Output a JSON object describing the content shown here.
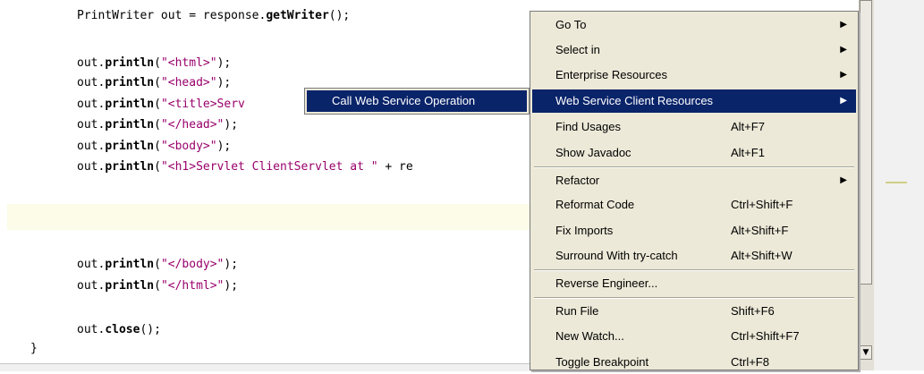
{
  "editor": {
    "lines": [
      {
        "parts": [
          {
            "t": "PrintWriter out = response.",
            "c": ""
          },
          {
            "t": "getWriter",
            "c": "kw"
          },
          {
            "t": "();",
            "c": ""
          }
        ]
      },
      {
        "parts": [
          {
            "t": "out.",
            "c": ""
          },
          {
            "t": "println",
            "c": "kw"
          },
          {
            "t": "(",
            "c": ""
          },
          {
            "t": "\"<html>\"",
            "c": "str"
          },
          {
            "t": ");",
            "c": ""
          }
        ]
      },
      {
        "parts": [
          {
            "t": "out.",
            "c": ""
          },
          {
            "t": "println",
            "c": "kw"
          },
          {
            "t": "(",
            "c": ""
          },
          {
            "t": "\"<head>\"",
            "c": "str"
          },
          {
            "t": ");",
            "c": ""
          }
        ]
      },
      {
        "parts": [
          {
            "t": "out.",
            "c": ""
          },
          {
            "t": "println",
            "c": "kw"
          },
          {
            "t": "(",
            "c": ""
          },
          {
            "t": "\"<title>Serv",
            "c": "str"
          }
        ]
      },
      {
        "parts": [
          {
            "t": "out.",
            "c": ""
          },
          {
            "t": "println",
            "c": "kw"
          },
          {
            "t": "(",
            "c": ""
          },
          {
            "t": "\"</head>\"",
            "c": "str"
          },
          {
            "t": ");",
            "c": ""
          }
        ]
      },
      {
        "parts": [
          {
            "t": "out.",
            "c": ""
          },
          {
            "t": "println",
            "c": "kw"
          },
          {
            "t": "(",
            "c": ""
          },
          {
            "t": "\"<body>\"",
            "c": "str"
          },
          {
            "t": ");",
            "c": ""
          }
        ]
      },
      {
        "parts": [
          {
            "t": "out.",
            "c": ""
          },
          {
            "t": "println",
            "c": "kw"
          },
          {
            "t": "(",
            "c": ""
          },
          {
            "t": "\"<h1>Servlet ClientServlet at \"",
            "c": "str"
          },
          {
            "t": " + re",
            "c": ""
          }
        ]
      },
      {
        "parts": [
          {
            "t": "out.",
            "c": ""
          },
          {
            "t": "println",
            "c": "kw"
          },
          {
            "t": "(",
            "c": ""
          },
          {
            "t": "\"</body>\"",
            "c": "str"
          },
          {
            "t": ");",
            "c": ""
          }
        ]
      },
      {
        "parts": [
          {
            "t": "out.",
            "c": ""
          },
          {
            "t": "println",
            "c": "kw"
          },
          {
            "t": "(",
            "c": ""
          },
          {
            "t": "\"</html>\"",
            "c": "str"
          },
          {
            "t": ");",
            "c": ""
          }
        ]
      },
      {
        "parts": [
          {
            "t": "out.",
            "c": ""
          },
          {
            "t": "close",
            "c": "kw"
          },
          {
            "t": "();",
            "c": ""
          }
        ]
      },
      {
        "parts": [
          {
            "t": "}",
            "c": ""
          }
        ]
      }
    ]
  },
  "context_menu": {
    "items": [
      {
        "label": "Go To",
        "shortcut": "",
        "submenu": true
      },
      {
        "label": "Select in",
        "shortcut": "",
        "submenu": true
      },
      {
        "label": "Enterprise Resources",
        "shortcut": "",
        "submenu": true
      },
      {
        "label": "Web Service Client Resources",
        "shortcut": "",
        "submenu": true,
        "active": true
      },
      {
        "label": "Find Usages",
        "shortcut": "Alt+F7",
        "submenu": false
      },
      {
        "label": "Show Javadoc",
        "shortcut": "Alt+F1",
        "submenu": false
      },
      {
        "label": "Refactor",
        "shortcut": "",
        "submenu": true
      },
      {
        "label": "Reformat Code",
        "shortcut": "Ctrl+Shift+F",
        "submenu": false
      },
      {
        "label": "Fix Imports",
        "shortcut": "Alt+Shift+F",
        "submenu": false
      },
      {
        "label": "Surround With try-catch",
        "shortcut": "Alt+Shift+W",
        "submenu": false
      },
      {
        "label": "Reverse Engineer...",
        "shortcut": "",
        "submenu": false
      },
      {
        "label": "Run File",
        "shortcut": "Shift+F6",
        "submenu": false
      },
      {
        "label": "New Watch...",
        "shortcut": "Ctrl+Shift+F7",
        "submenu": false
      },
      {
        "label": "Toggle Breakpoint",
        "shortcut": "Ctrl+F8",
        "submenu": false
      }
    ]
  },
  "submenu": {
    "label": "Call Web Service Operation"
  },
  "colors": {
    "menu_highlight": "#0a246a",
    "menu_bg": "#ece9d8",
    "string_color": "#99006b",
    "current_line": "#fcfce8"
  }
}
